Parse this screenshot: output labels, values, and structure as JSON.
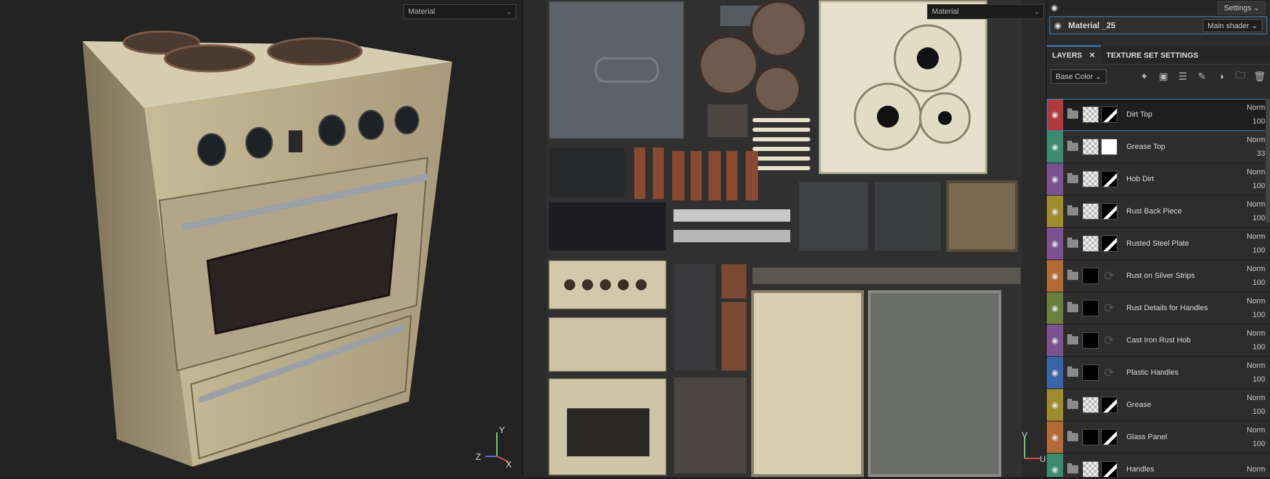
{
  "viewport_3d": {
    "mode_dropdown": "Material",
    "axis_labels": {
      "y": "Y",
      "z": "Z",
      "x": "X"
    }
  },
  "viewport_2d": {
    "mode_dropdown": "Material",
    "axis_labels": {
      "v": "V",
      "u": "U"
    }
  },
  "panel": {
    "settings_label": "Settings",
    "material_name": "Material _25",
    "shader_label": "Main shader",
    "tabs": [
      {
        "label": "LAYERS"
      },
      {
        "label": "TEXTURE SET SETTINGS"
      }
    ],
    "channel_select": "Base Color",
    "toolbar_icons": [
      "magic-wand-icon",
      "add-fill-layer-icon",
      "add-layer-icon",
      "add-paint-icon",
      "add-effect-icon",
      "add-folder-icon",
      "delete-icon"
    ],
    "layers": [
      {
        "name": "Dirt Top",
        "blend": "Norm",
        "opacity": "100",
        "color": "#b03a3a",
        "thumb": "checker",
        "mask": "mask-p",
        "selected": true
      },
      {
        "name": "Grease Top",
        "blend": "Norm",
        "opacity": "33",
        "color": "#3c8a72",
        "thumb": "checker",
        "mask": "mask-w"
      },
      {
        "name": "Hob Dirt",
        "blend": "Norm",
        "opacity": "100",
        "color": "#7a5290",
        "thumb": "checker",
        "mask": "mask-p"
      },
      {
        "name": "Rust Back Piece",
        "blend": "Norm",
        "opacity": "100",
        "color": "#a08a2e",
        "thumb": "checker",
        "mask": "mask-p"
      },
      {
        "name": "Rusted Steel Plate",
        "blend": "Norm",
        "opacity": "100",
        "color": "#7a5290",
        "thumb": "checker",
        "mask": "mask-p"
      },
      {
        "name": "Rust on Silver Strips",
        "blend": "Norm",
        "opacity": "100",
        "color": "#b26a36",
        "thumb": "mask-b",
        "mask": "ring"
      },
      {
        "name": "Rust Details for Handles",
        "blend": "Norm",
        "opacity": "100",
        "color": "#6e7e3e",
        "thumb": "mask-b",
        "mask": "ring"
      },
      {
        "name": "Cast Iron Rust Hob",
        "blend": "Norm",
        "opacity": "100",
        "color": "#7a5290",
        "thumb": "mask-b",
        "mask": "ring"
      },
      {
        "name": "Plastic Handles",
        "blend": "Norm",
        "opacity": "100",
        "color": "#3a64a8",
        "thumb": "mask-b",
        "mask": "ring"
      },
      {
        "name": "Grease",
        "blend": "Norm",
        "opacity": "100",
        "color": "#a08a2e",
        "thumb": "checker",
        "mask": "mask-p"
      },
      {
        "name": "Glass Panel",
        "blend": "Norm",
        "opacity": "100",
        "color": "#b26a36",
        "thumb": "mask-b",
        "mask": "mask-p"
      },
      {
        "name": "Handles",
        "blend": "Norm",
        "opacity": "",
        "color": "#3c8a72",
        "thumb": "checker",
        "mask": "mask-p"
      }
    ]
  }
}
